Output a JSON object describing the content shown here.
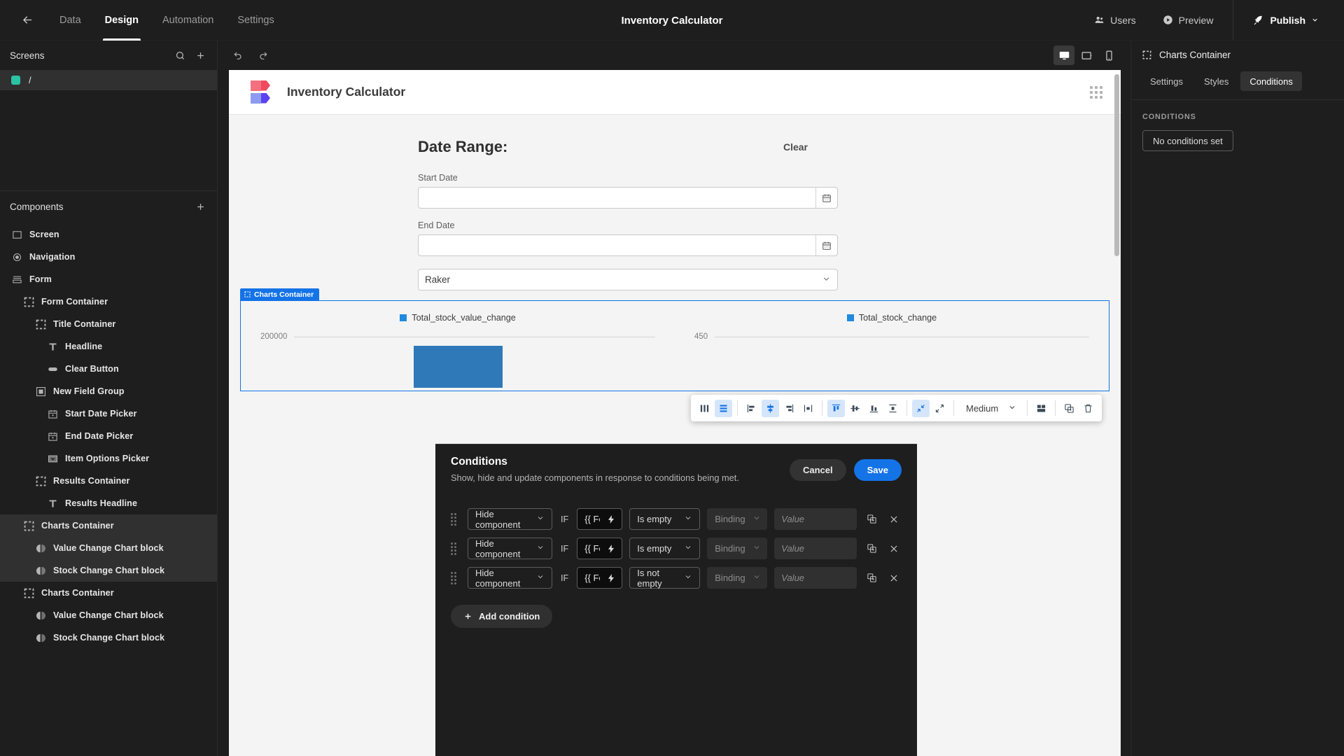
{
  "topbar": {
    "back_icon": "arrow-left-icon",
    "tabs": [
      {
        "label": "Data",
        "active": false
      },
      {
        "label": "Design",
        "active": true
      },
      {
        "label": "Automation",
        "active": false
      },
      {
        "label": "Settings",
        "active": false
      }
    ],
    "title": "Inventory Calculator",
    "users_label": "Users",
    "preview_label": "Preview",
    "publish_label": "Publish"
  },
  "left_panel": {
    "screens_title": "Screens",
    "screens": [
      {
        "label": "/",
        "color": "#2bc4a3"
      }
    ],
    "components_title": "Components",
    "tree": [
      {
        "label": "Screen",
        "indent": 0,
        "icon": "screen-icon",
        "selected": false
      },
      {
        "label": "Navigation",
        "indent": 0,
        "icon": "eye-icon",
        "selected": false
      },
      {
        "label": "Form",
        "indent": 0,
        "icon": "form-icon",
        "selected": false
      },
      {
        "label": "Form Container",
        "indent": 1,
        "icon": "container-icon",
        "selected": false
      },
      {
        "label": "Title Container",
        "indent": 2,
        "icon": "container-icon",
        "selected": false
      },
      {
        "label": "Headline",
        "indent": 3,
        "icon": "text-icon",
        "selected": false
      },
      {
        "label": "Clear Button",
        "indent": 3,
        "icon": "button-icon",
        "selected": false
      },
      {
        "label": "New Field Group",
        "indent": 2,
        "icon": "fieldgroup-icon",
        "selected": false
      },
      {
        "label": "Start Date Picker",
        "indent": 3,
        "icon": "calendar-icon",
        "selected": false
      },
      {
        "label": "End Date Picker",
        "indent": 3,
        "icon": "calendar-icon",
        "selected": false
      },
      {
        "label": "Item Options Picker",
        "indent": 3,
        "icon": "dropdown-icon",
        "selected": false
      },
      {
        "label": "Results Container",
        "indent": 2,
        "icon": "container-icon",
        "selected": false
      },
      {
        "label": "Results Headline",
        "indent": 3,
        "icon": "text-icon",
        "selected": false
      },
      {
        "label": "Charts Container",
        "indent": 1,
        "icon": "container-icon",
        "selected": true
      },
      {
        "label": "Value Change Chart block",
        "indent": 2,
        "icon": "chart-icon",
        "selected": true
      },
      {
        "label": "Stock Change Chart block",
        "indent": 2,
        "icon": "chart-icon",
        "selected": true
      },
      {
        "label": "Charts Container",
        "indent": 1,
        "icon": "container-icon",
        "selected": false
      },
      {
        "label": "Value Change Chart block",
        "indent": 2,
        "icon": "chart-icon",
        "selected": false
      },
      {
        "label": "Stock Change Chart block",
        "indent": 2,
        "icon": "chart-icon",
        "selected": false
      }
    ]
  },
  "center": {
    "undo_icon": "undo-icon",
    "redo_icon": "redo-icon",
    "devices": [
      {
        "name": "desktop-icon",
        "active": true
      },
      {
        "name": "tablet-icon",
        "active": false
      },
      {
        "name": "mobile-icon",
        "active": false
      }
    ],
    "app_name": "Inventory Calculator",
    "form": {
      "title": "Date Range:",
      "clear_label": "Clear",
      "start_label": "Start Date",
      "start_value": "",
      "end_label": "End Date",
      "end_value": "",
      "select_value": "Raker"
    },
    "toolbar": {
      "size_label": "Medium",
      "icons": [
        {
          "name": "columns-layout-icon",
          "active": false
        },
        {
          "name": "rows-layout-icon",
          "active": true
        },
        {
          "name": "align-left-icon",
          "active": false
        },
        {
          "name": "align-center-icon",
          "active": true
        },
        {
          "name": "align-right-icon",
          "active": false
        },
        {
          "name": "distribute-h-icon",
          "active": false
        },
        {
          "name": "align-top-icon",
          "active": true
        },
        {
          "name": "align-middle-icon",
          "active": false
        },
        {
          "name": "align-bottom-icon",
          "active": false
        },
        {
          "name": "distribute-v-icon",
          "active": false
        },
        {
          "name": "shrink-icon",
          "active": true
        },
        {
          "name": "grow-icon",
          "active": false
        }
      ],
      "extra_icons": [
        {
          "name": "layout-icon"
        },
        {
          "name": "duplicate-icon"
        },
        {
          "name": "delete-icon"
        }
      ]
    },
    "charts_tag": "Charts Container",
    "chart_data": {
      "type": "bar",
      "title": "",
      "panels": [
        {
          "legend": "Total_stock_value_change",
          "axis_tick": "200000",
          "categories": [
            ""
          ],
          "values": [
            200000
          ],
          "color": "#3079b8"
        },
        {
          "legend": "Total_stock_change",
          "axis_tick": "450",
          "categories": [
            ""
          ],
          "values": [],
          "color": "#3079b8"
        }
      ],
      "legend_position": "top",
      "grid": false
    }
  },
  "drawer": {
    "title": "Conditions",
    "subtitle": "Show, hide and update components in response to conditions being met.",
    "cancel_label": "Cancel",
    "save_label": "Save",
    "if_label": "IF",
    "add_label": "Add condition",
    "value_placeholder": "Value",
    "rows": [
      {
        "action": "Hide component",
        "binding": "{{ Form.Fields.Start Date }}",
        "operator": "Is empty",
        "type": "Binding",
        "value": ""
      },
      {
        "action": "Hide component",
        "binding": "{{ Form.Fields.End Date }}",
        "operator": "Is empty",
        "type": "Binding",
        "value": ""
      },
      {
        "action": "Hide component",
        "binding": "{{ Form.Fields.Item Name }}",
        "operator": "Is not empty",
        "type": "Binding",
        "value": ""
      }
    ]
  },
  "right_panel": {
    "component_name": "Charts Container",
    "tabs": [
      {
        "label": "Settings",
        "active": false
      },
      {
        "label": "Styles",
        "active": false
      },
      {
        "label": "Conditions",
        "active": true
      }
    ],
    "section_label": "CONDITIONS",
    "no_conditions_label": "No conditions set"
  }
}
